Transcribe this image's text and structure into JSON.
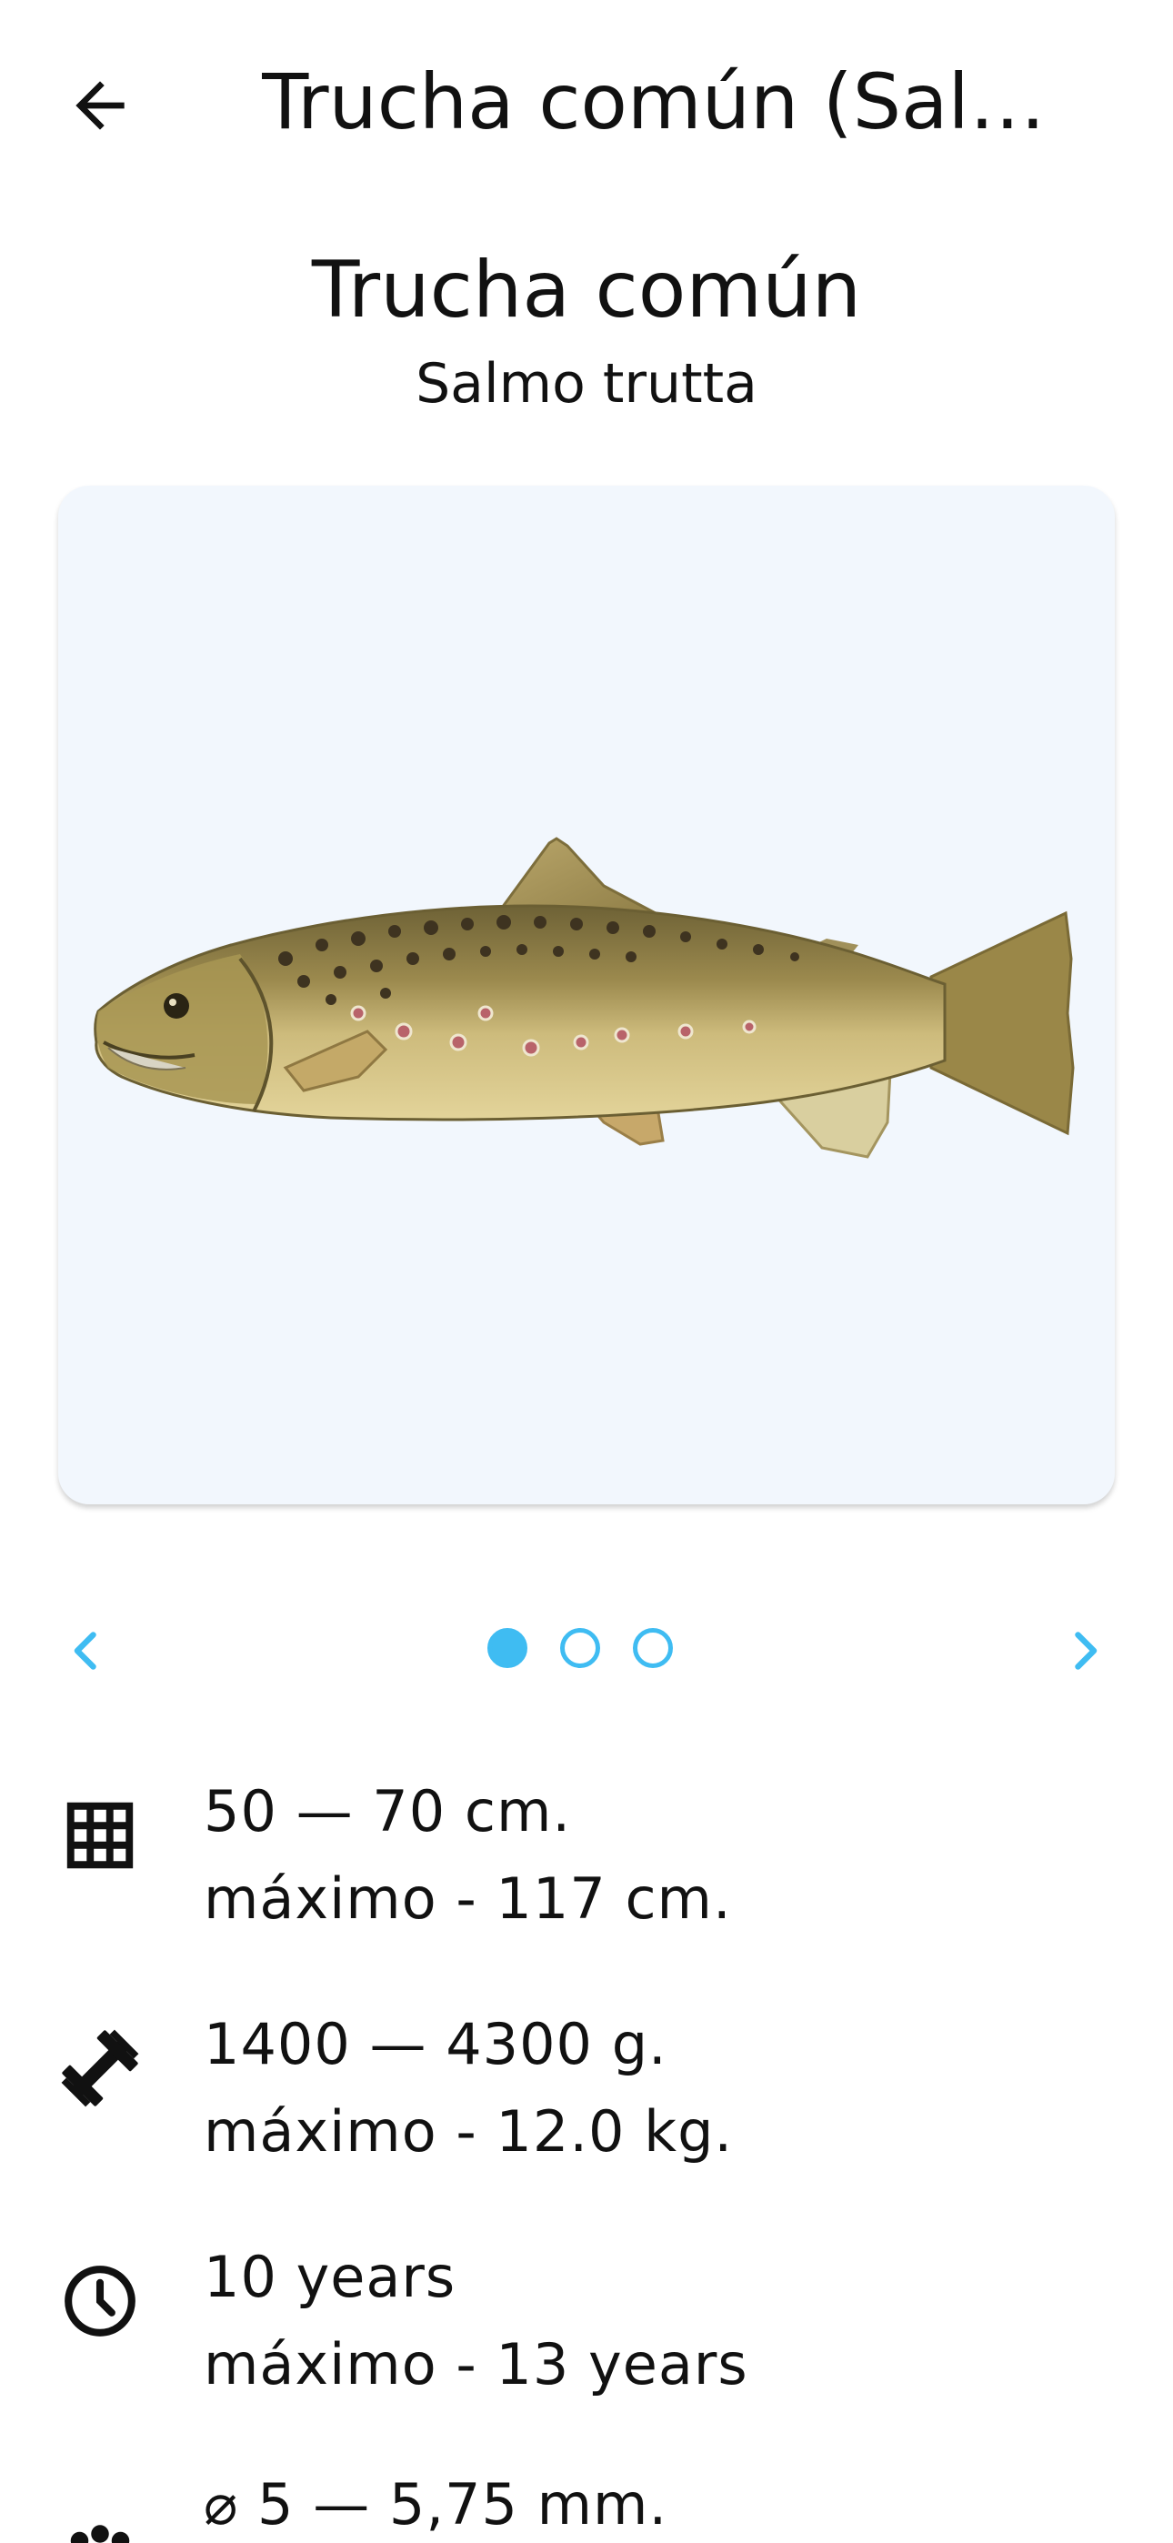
{
  "appbar": {
    "title": "Trucha común (Salm…",
    "back_icon": "arrow-left-icon"
  },
  "header": {
    "common_name": "Trucha común",
    "latin_name": "Salmo trutta"
  },
  "image_card": {
    "background_color": "#f2f7fd",
    "image_description_icon": "fish-illustration"
  },
  "carousel": {
    "prev_icon": "chevron-left-icon",
    "next_icon": "chevron-right-icon",
    "accent_color": "#3fbcf2",
    "active_index": 0,
    "count": 3
  },
  "stats": {
    "length": {
      "icon": "grid-icon",
      "range": "50 — 70 cm.",
      "max": "máximo - 117 cm."
    },
    "weight": {
      "icon": "dumbbell-icon",
      "range": "1400 — 4300 g.",
      "max": "máximo - 12.0 kg."
    },
    "lifespan": {
      "icon": "clock-icon",
      "range": "10 years",
      "max": "máximo - 13 years"
    },
    "eggs": {
      "icon": "dots-icon",
      "range": "⌀ 5 — 5,75 mm."
    }
  }
}
